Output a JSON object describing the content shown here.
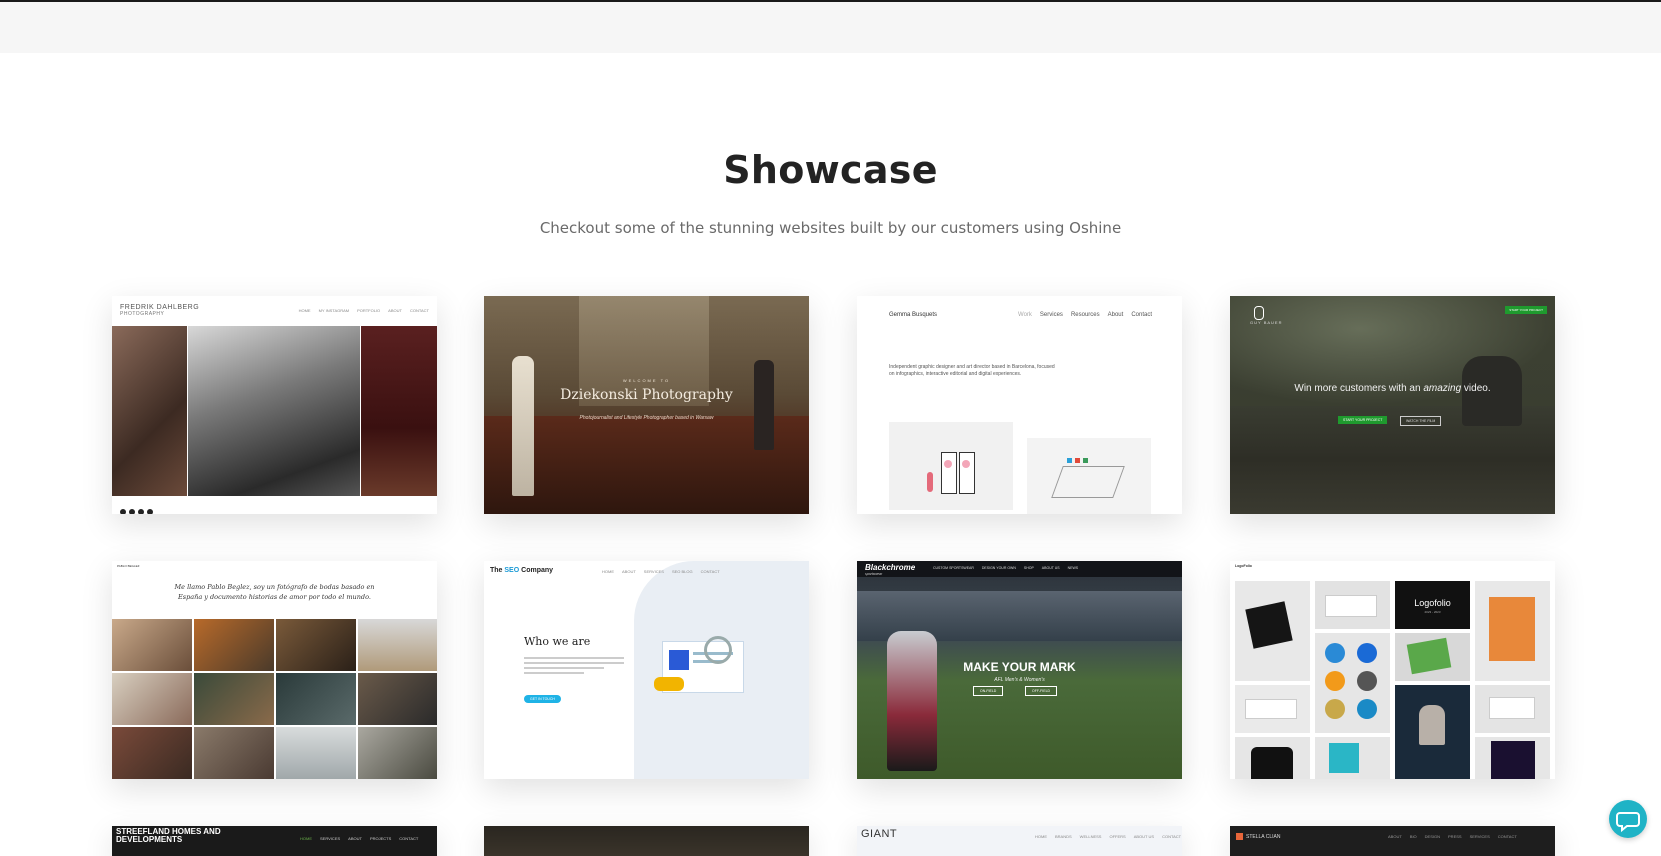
{
  "section": {
    "title": "Showcase",
    "subtitle": "Checkout some of the stunning websites built by our customers using Oshine"
  },
  "cards": [
    {
      "brand": "FREDRIK DAHLBERG",
      "brand_sub": "PHOTOGRAPHY",
      "nav": [
        "HOME",
        "MY INSTAGRAM",
        "PORTFOLIO",
        "ABOUT",
        "CONTACT"
      ]
    },
    {
      "welcome": "WELCOME TO",
      "headline": "Dziekonski Photography",
      "tagline": "Photojournalist and Lifestyle Photographer based in Warsaw"
    },
    {
      "brand": "Gemma Busquets",
      "nav": [
        "Work",
        "Services",
        "Resources",
        "About",
        "Contact"
      ],
      "intro": "Independent graphic designer and art director based in Barcelona, focused on infographics, interactive editorial and digital experiences."
    },
    {
      "brand": "GUY BAUER",
      "cta_nav": "START YOUR PROJECT",
      "headline_pre": "Win more customers with an ",
      "headline_em": "amazing",
      "headline_post": " video.",
      "btn_primary": "START YOUR PROJECT",
      "btn_secondary": "WATCH THE FILM"
    },
    {
      "brand": "PABLO BEGLEZ",
      "headline": "Me llamo Pablo Beglez, soy un fotógrafo de bodas basado en España y documento historias de amor por todo el mundo."
    },
    {
      "brand_pre": "The ",
      "brand_mid": "SEO",
      "brand_post": " Company",
      "nav": [
        "HOME",
        "ABOUT",
        "SERVICES",
        "SEO BLOG",
        "CONTACT"
      ],
      "heading": "Who we are",
      "btn": "GET IN TOUCH"
    },
    {
      "brand": "Blackchrome",
      "brand_sub": "sportswear",
      "nav": [
        "CUSTOM SPORTSWEAR",
        "DESIGN YOUR OWN",
        "SHOP",
        "ABOUT US",
        "NEWS"
      ],
      "headline": "MAKE YOUR MARK",
      "sub": "AFL Men's & Women's",
      "btn1": "ON-FIELD",
      "btn2": "OFF-FIELD"
    },
    {
      "brand": "LogoFolio",
      "tile": "Logofolio",
      "tile_sub": "2023 - 2023"
    },
    {
      "brand": "STREEFLAND HOMES AND DEVELOPMENTS",
      "nav": [
        "HOME",
        "SERVICES",
        "ABOUT",
        "PROJECTS",
        "CONTACT"
      ]
    },
    {
      "brand": ""
    },
    {
      "brand": "GIANT",
      "nav": [
        "HOME",
        "BRANDS",
        "WELLNESS",
        "OFFERS",
        "ABOUT US",
        "CONTACT"
      ]
    },
    {
      "brand": "STELLA CLIAN",
      "nav": [
        "ABOUT",
        "BIO",
        "DESIGN",
        "PRESS",
        "SERVICES",
        "CONTACT"
      ]
    }
  ],
  "chat": {
    "icon": "chat-bubble-icon"
  },
  "colors": {
    "accent": "#1fb3c6",
    "title": "#232323",
    "subtitle": "#6a6a6a",
    "band": "#f6f6f6"
  }
}
